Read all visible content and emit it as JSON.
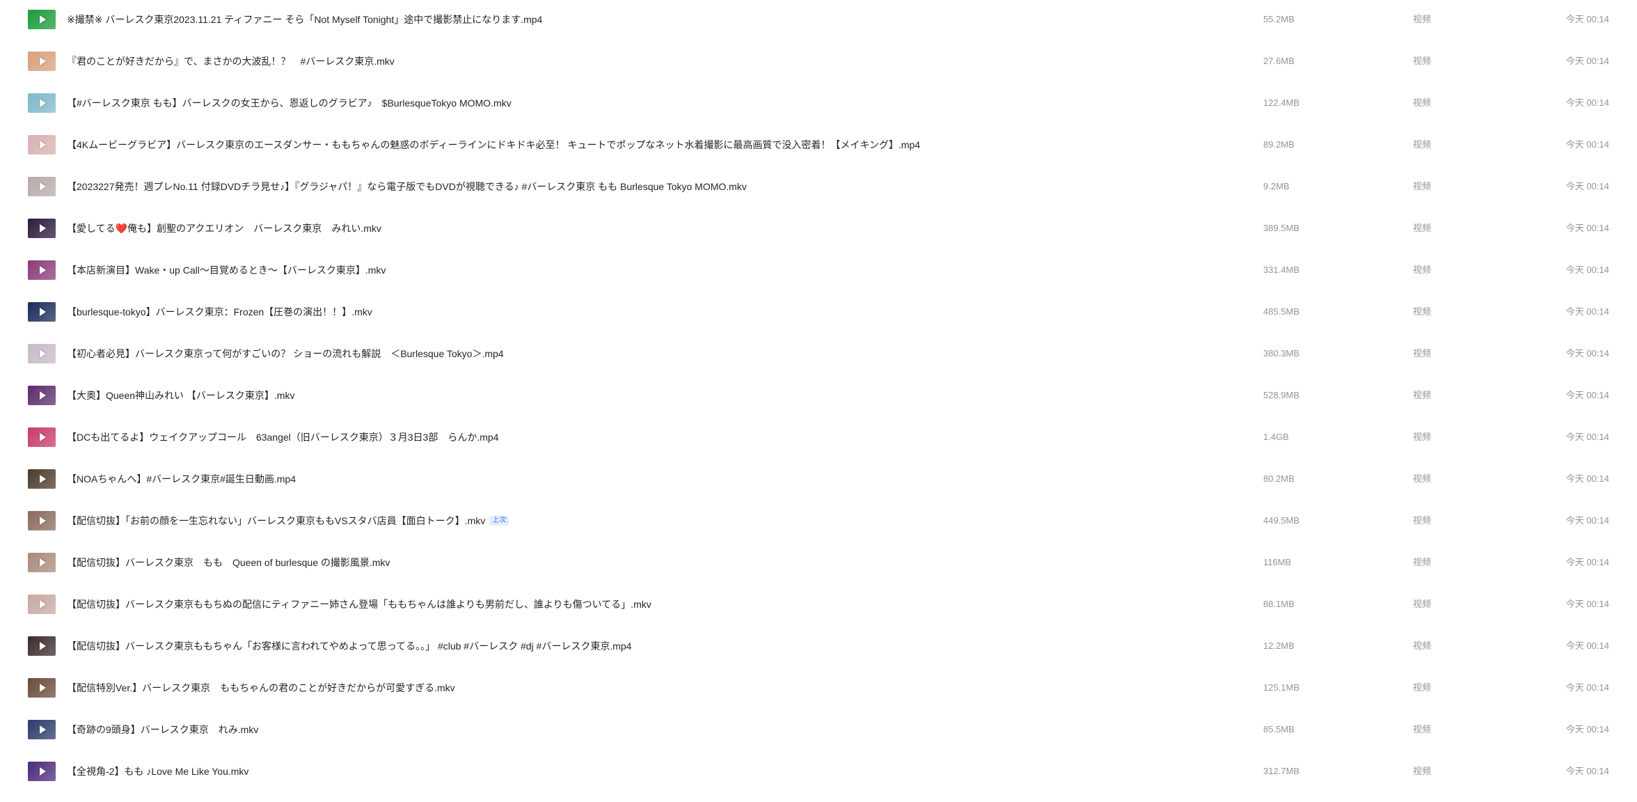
{
  "files": [
    {
      "name": "※撮禁※ バーレスク東京2023.11.21 ティファニー そら「Not Myself Tonight」途中で撮影禁止になります.mp4",
      "tag": "",
      "size": "55.2MB",
      "type": "视频",
      "time": "今天 00:14",
      "color": "#1a9a3a"
    },
    {
      "name": "『君のことが好きだから』で、まさかの大波乱！？　#バーレスク東京.mkv",
      "tag": "",
      "size": "27.6MB",
      "type": "视频",
      "time": "今天 00:14",
      "color": "#d8a07a"
    },
    {
      "name": "【#バーレスク東京 もも】バーレスクの女王から、恩返しのグラビア♪　$BurlesqueTokyo MOMO.mkv",
      "tag": "",
      "size": "122.4MB",
      "type": "视频",
      "time": "今天 00:14",
      "color": "#7fb7c9"
    },
    {
      "name": "【4Kムービーグラビア】バーレスク東京のエースダンサー・ももちゃんの魅惑のボディーラインにドキドキ必至！ キュートでポップなネット水着撮影に最高画質で没入密着！【メイキング】.mp4",
      "tag": "",
      "size": "89.2MB",
      "type": "视频",
      "time": "今天 00:14",
      "color": "#d8b0b0"
    },
    {
      "name": "【2023227発売！週プレNo.11 付録DVDチラ見せ♪】『グラジャパ！』なら電子版でもDVDが視聴できる♪ #バーレスク東京 もも Burlesque Tokyo MOMO.mkv",
      "tag": "",
      "size": "9.2MB",
      "type": "视频",
      "time": "今天 00:14",
      "color": "#b8aaa8"
    },
    {
      "name": "【愛してる❤️俺も】創聖のアクエリオン　バーレスク東京　みれい.mkv",
      "tag": "",
      "size": "389.5MB",
      "type": "视频",
      "time": "今天 00:14",
      "color": "#2a1a3a"
    },
    {
      "name": "【本店新演目】Wake・up Call〜目覚めるとき〜【バーレスク東京】.mkv",
      "tag": "",
      "size": "331.4MB",
      "type": "视频",
      "time": "今天 00:14",
      "color": "#8a3a7a"
    },
    {
      "name": "【burlesque-tokyo】バーレスク東京：Frozen【圧巻の演出！！】.mkv",
      "tag": "",
      "size": "485.5MB",
      "type": "视频",
      "time": "今天 00:14",
      "color": "#1a2a5a"
    },
    {
      "name": "【初心者必見】バーレスク東京って何がすごいの？ ショーの流れも解説　＜Burlesque Tokyo＞.mp4",
      "tag": "",
      "size": "380.3MB",
      "type": "视频",
      "time": "今天 00:14",
      "color": "#c8b8c8"
    },
    {
      "name": "【大奥】Queen神山みれい 【バーレスク東京】.mkv",
      "tag": "",
      "size": "528.9MB",
      "type": "视频",
      "time": "今天 00:14",
      "color": "#5a2a6a"
    },
    {
      "name": "【DCも出てるよ】ウェイクアップコール　63angel（旧バーレスク東京）３月3日3部　らんか.mp4",
      "tag": "",
      "size": "1.4GB",
      "type": "视频",
      "time": "今天 00:14",
      "color": "#c83a6a"
    },
    {
      "name": "【NOAちゃんへ】#バーレスク東京#誕生日動画.mp4",
      "tag": "",
      "size": "80.2MB",
      "type": "视频",
      "time": "今天 00:14",
      "color": "#4a3a2a"
    },
    {
      "name": "【配信切抜】「お前の顔を一生忘れない」バーレスク東京ももVSスタバ店員【面白トーク】.mkv",
      "tag": "上次",
      "size": "449.5MB",
      "type": "视频",
      "time": "今天 00:14",
      "color": "#8a6a5a"
    },
    {
      "name": "【配信切抜】バーレスク東京　もも　Queen of burlesque の撮影風景.mkv",
      "tag": "",
      "size": "116MB",
      "type": "视频",
      "time": "今天 00:14",
      "color": "#a88a7a"
    },
    {
      "name": "【配信切抜】バーレスク東京ももちぬの配信にティファニー姉さん登場「ももちゃんは誰よりも男前だし、誰よりも傷ついてる」.mkv",
      "tag": "",
      "size": "88.1MB",
      "type": "视频",
      "time": "今天 00:14",
      "color": "#c8a8a0"
    },
    {
      "name": "【配信切抜】バーレスク東京ももちゃん「お客様に言われてやめよって思ってる。。」 #club #バーレスク #dj #バーレスク東京.mp4",
      "tag": "",
      "size": "12.2MB",
      "type": "视频",
      "time": "今天 00:14",
      "color": "#3a2a2a"
    },
    {
      "name": "【配信特別Ver.】バーレスク東京　ももちゃんの君のことが好きだからが可愛すぎる.mkv",
      "tag": "",
      "size": "125.1MB",
      "type": "视频",
      "time": "今天 00:14",
      "color": "#6a4a3a"
    },
    {
      "name": "【奇跡の9頭身】バーレスク東京　れみ.mkv",
      "tag": "",
      "size": "85.5MB",
      "type": "视频",
      "time": "今天 00:14",
      "color": "#2a3a6a"
    },
    {
      "name": "【全視角-2】もも ♪Love Me Like You.mkv",
      "tag": "",
      "size": "312.7MB",
      "type": "视频",
      "time": "今天 00:14",
      "color": "#4a2a7a"
    }
  ]
}
